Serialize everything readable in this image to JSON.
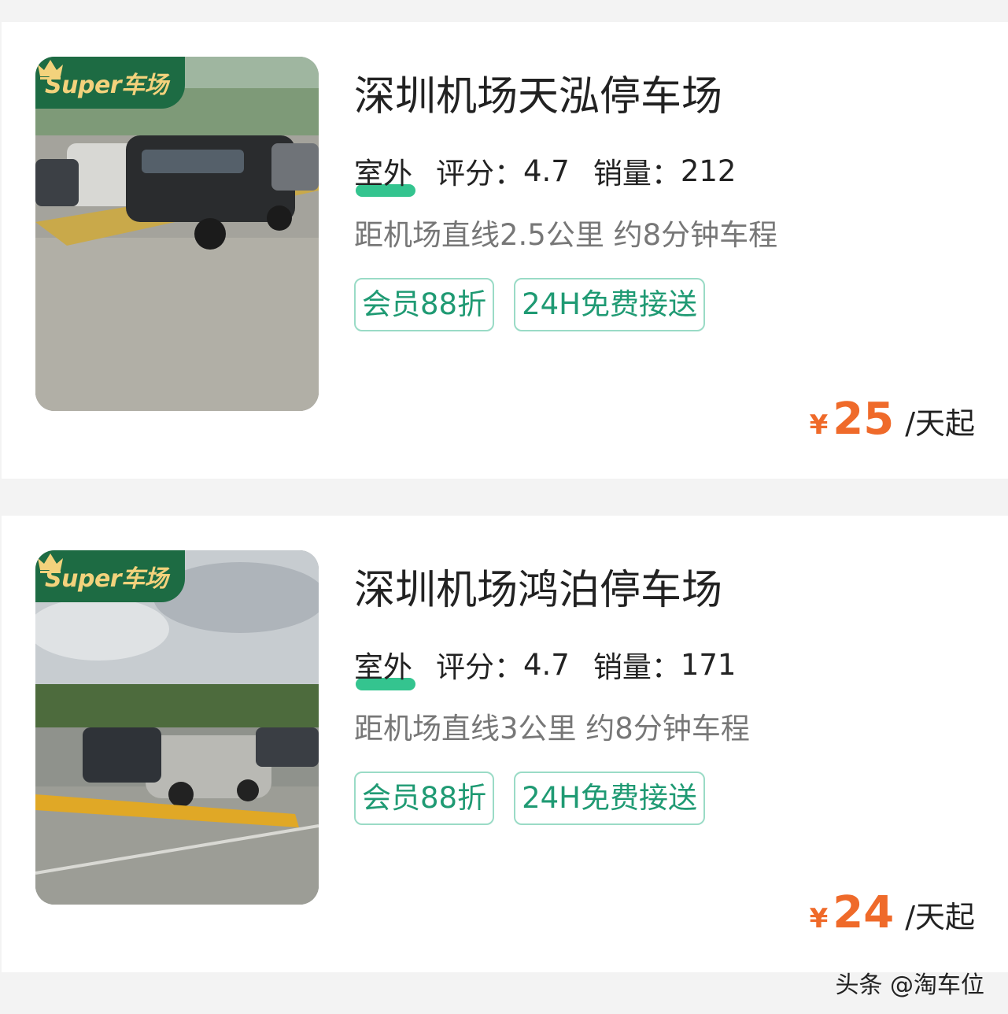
{
  "listings": [
    {
      "badge": "Super车场",
      "name": "深圳机场天泓停车场",
      "type": "室外",
      "rating_label": "评分：",
      "rating": "4.7",
      "sales_label": "销量：",
      "sales": "212",
      "distance": "距机场直线2.5公里 约8分钟车程",
      "tags": [
        "会员88折",
        "24H免费接送"
      ],
      "currency": "¥",
      "price": "25",
      "price_unit": "/天起"
    },
    {
      "badge": "Super车场",
      "name": "深圳机场鸿泊停车场",
      "type": "室外",
      "rating_label": "评分：",
      "rating": "4.7",
      "sales_label": "销量：",
      "sales": "171",
      "distance": "距机场直线3公里 约8分钟车程",
      "tags": [
        "会员88折",
        "24H免费接送"
      ],
      "currency": "¥",
      "price": "24",
      "price_unit": "/天起"
    }
  ],
  "watermark": "头条 @淘车位",
  "colors": {
    "accent_green": "#1d6b43",
    "tag_green": "#1f9a73",
    "price_orange": "#ef6a2a",
    "badge_gold": "#f3d27c"
  },
  "icons": [
    "crown-icon"
  ]
}
